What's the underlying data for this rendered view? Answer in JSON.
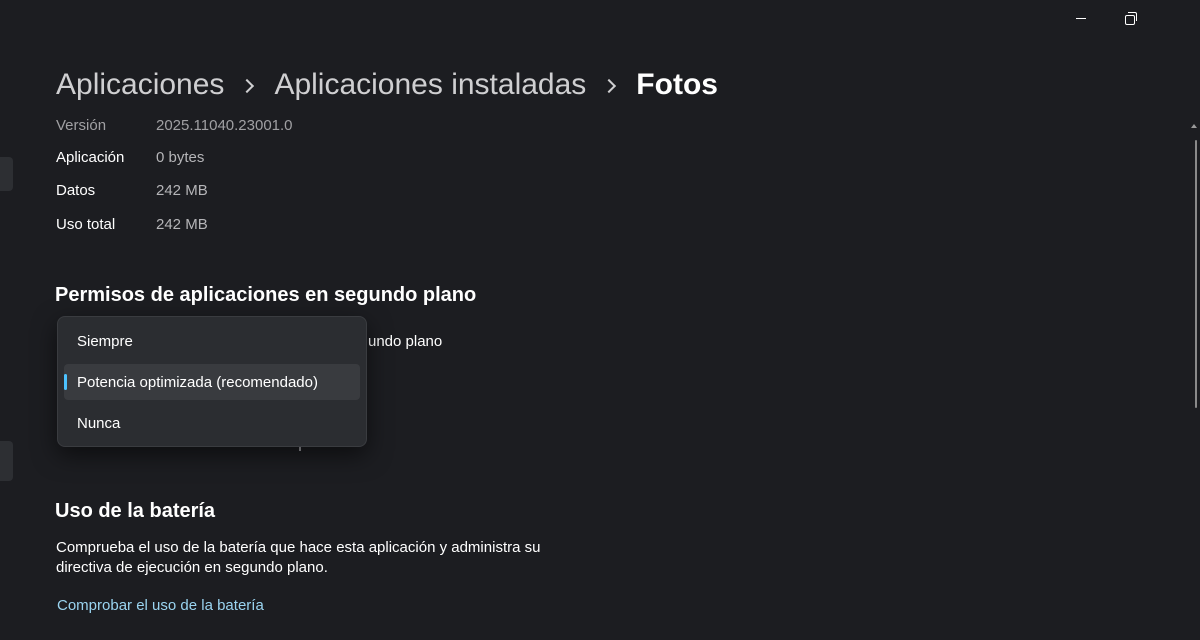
{
  "window": {
    "controls": {
      "minimize_icon": "minimize-icon",
      "restore_icon": "restore-icon"
    }
  },
  "breadcrumb": {
    "items": [
      "Aplicaciones",
      "Aplicaciones instaladas",
      "Fotos"
    ],
    "separator_icon": "chevron-right-icon"
  },
  "specs": [
    {
      "label": "Versión",
      "value": "2025.11040.23001.0"
    },
    {
      "label": "Aplicación",
      "value": "0 bytes"
    },
    {
      "label": "Datos",
      "value": "242 MB"
    },
    {
      "label": "Uso total",
      "value": "242 MB"
    }
  ],
  "background_permissions": {
    "title": "Permisos de aplicaciones en segundo plano",
    "hidden_label_fragment": "undo plano",
    "dropdown": {
      "options": [
        "Siempre",
        "Potencia optimizada (recomendado)",
        "Nunca"
      ],
      "selected": "Potencia optimizada (recomendado)",
      "selected_index": 1
    }
  },
  "battery": {
    "title": "Uso de la batería",
    "description": "Comprueba el uso de la batería que hace esta aplicación y administra su directiva de ejecución en segundo plano.",
    "link": "Comprobar el uso de la batería"
  },
  "colors": {
    "background": "#1c1d21",
    "accent": "#4cc2ff",
    "link": "#9ad4f0",
    "flyout": "#2b2d31"
  }
}
